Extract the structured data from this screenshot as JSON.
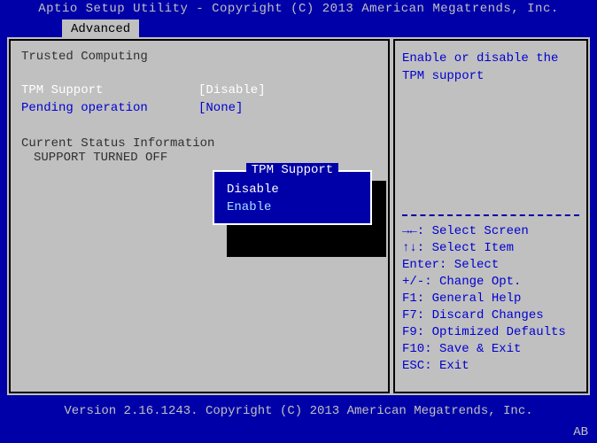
{
  "header": {
    "title": "Aptio Setup Utility - Copyright (C) 2013 American Megatrends, Inc."
  },
  "tabs": {
    "active": "Advanced"
  },
  "page": {
    "section_title": "Trusted Computing",
    "items": [
      {
        "label": "TPM Support",
        "value": "[Disable]",
        "selected": true
      },
      {
        "label": "Pending operation",
        "value": "[None]",
        "selected": false
      }
    ],
    "status_header": "Current Status Information",
    "status_value": "SUPPORT TURNED OFF"
  },
  "popup": {
    "title": "TPM Support",
    "options": [
      "Disable",
      "Enable"
    ],
    "selected_index": 0
  },
  "help": {
    "description": "Enable or disable the TPM support",
    "keys": [
      "→←: Select Screen",
      "↑↓: Select Item",
      "Enter: Select",
      "+/-: Change Opt.",
      "F1: General Help",
      "F7: Discard Changes",
      "F9: Optimized Defaults",
      "F10: Save & Exit",
      "ESC: Exit"
    ]
  },
  "footer": {
    "version": "Version 2.16.1243. Copyright (C) 2013 American Megatrends, Inc.",
    "corner": "AB"
  }
}
